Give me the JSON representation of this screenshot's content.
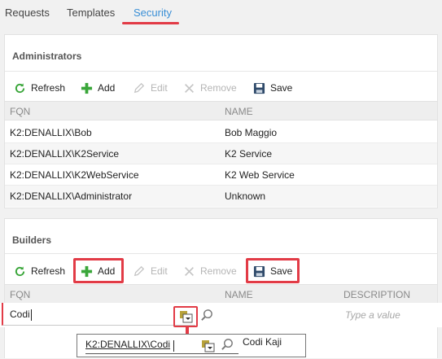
{
  "tabs": [
    {
      "label": "Requests"
    },
    {
      "label": "Templates"
    },
    {
      "label": "Security"
    }
  ],
  "active_tab": "Security",
  "toolbar": {
    "refresh": "Refresh",
    "add": "Add",
    "edit": "Edit",
    "remove": "Remove",
    "save": "Save"
  },
  "administrators": {
    "title": "Administrators",
    "columns": {
      "fqn": "FQN",
      "name": "NAME"
    },
    "rows": [
      {
        "fqn": "K2:DENALLIX\\Bob",
        "name": "Bob Maggio"
      },
      {
        "fqn": "K2:DENALLIX\\K2Service",
        "name": "K2 Service"
      },
      {
        "fqn": "K2:DENALLIX\\K2WebService",
        "name": "K2 Web Service"
      },
      {
        "fqn": "K2:DENALLIX\\Administrator",
        "name": "Unknown"
      }
    ]
  },
  "builders": {
    "title": "Builders",
    "columns": {
      "fqn": "FQN",
      "name": "NAME",
      "description": "DESCRIPTION"
    },
    "edit_row": {
      "fqn_value": "Codi",
      "description_placeholder": "Type a value"
    },
    "suggestion": {
      "fqn": "K2:DENALLIX\\Codi",
      "name": "Codi Kaji"
    }
  },
  "colors": {
    "accent": "#3a8fd6",
    "highlight": "#e23b46",
    "add_green": "#3aa63a"
  },
  "icons": [
    "refresh-icon",
    "add-icon",
    "edit-icon",
    "remove-icon",
    "save-icon",
    "picker-icon",
    "search-icon",
    "arrow-down-icon"
  ]
}
